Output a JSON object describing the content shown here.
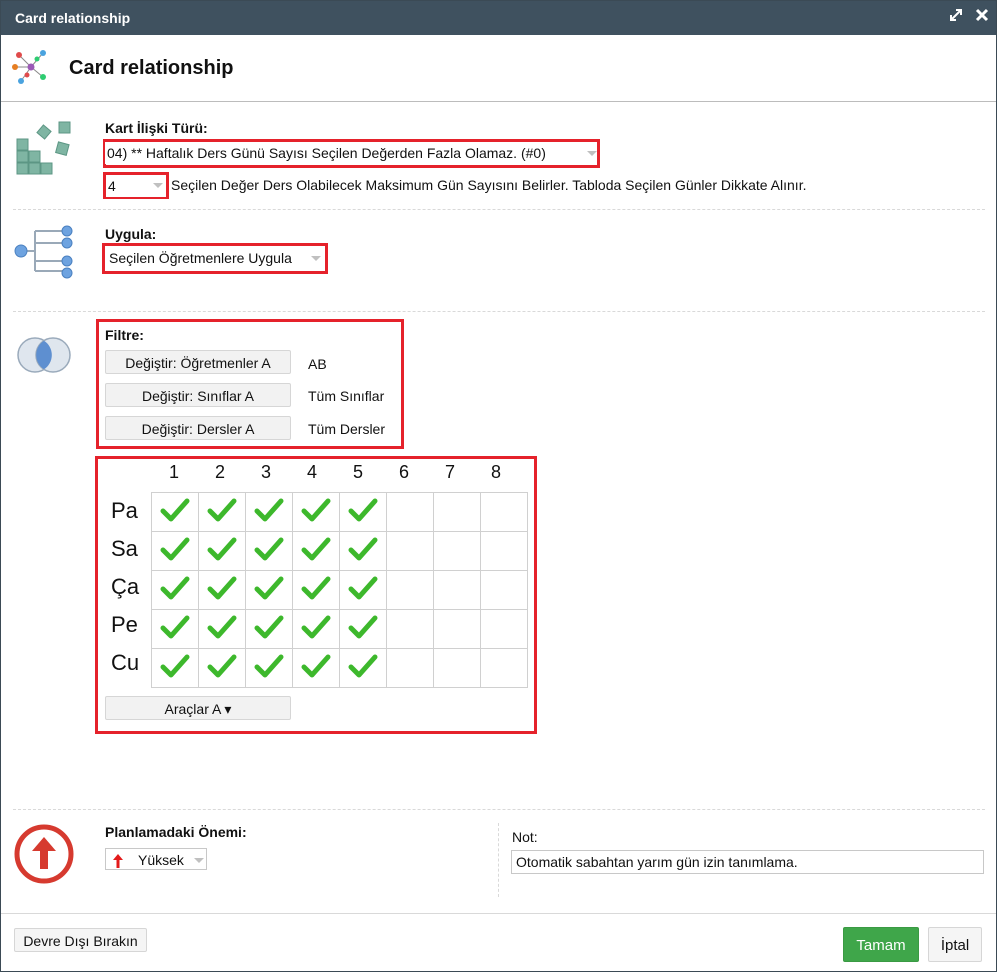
{
  "window": {
    "title": "Card relationship"
  },
  "header": {
    "title": "Card relationship"
  },
  "relation": {
    "label": "Kart İlişki Türü:",
    "type_value": "04) ** Haftalık Ders Günü Sayısı Seçilen Değerden Fazla Olamaz. (#0)",
    "count_value": "4",
    "description": "Seçilen Değer Ders Olabilecek Maksimum Gün Sayısını Belirler. Tabloda Seçilen Günler Dikkate Alınır."
  },
  "apply": {
    "label": "Uygula:",
    "value": "Seçilen Öğretmenlere Uygula"
  },
  "filter": {
    "label": "Filtre:",
    "rows": [
      {
        "button": "Değiştir: Öğretmenler A",
        "value": "AB"
      },
      {
        "button": "Değiştir: Sınıflar A",
        "value": "Tüm Sınıflar"
      },
      {
        "button": "Değiştir: Dersler A",
        "value": "Tüm Dersler"
      }
    ]
  },
  "schedule": {
    "columns": [
      "1",
      "2",
      "3",
      "4",
      "5",
      "6",
      "7",
      "8"
    ],
    "days": [
      "Pa",
      "Sa",
      "Ça",
      "Pe",
      "Cu"
    ],
    "checked": [
      [
        1,
        1,
        1,
        1,
        1,
        0,
        0,
        0
      ],
      [
        1,
        1,
        1,
        1,
        1,
        0,
        0,
        0
      ],
      [
        1,
        1,
        1,
        1,
        1,
        0,
        0,
        0
      ],
      [
        1,
        1,
        1,
        1,
        1,
        0,
        0,
        0
      ],
      [
        1,
        1,
        1,
        1,
        1,
        0,
        0,
        0
      ]
    ],
    "tools_button": "Araçlar A ▾"
  },
  "importance": {
    "label": "Planlamadaki Önemi:",
    "value": "Yüksek"
  },
  "note": {
    "label": "Not:",
    "value": "Otomatik sabahtan yarım gün izin tanımlama."
  },
  "footer": {
    "disable_button": "Devre Dışı Bırakın",
    "ok_button": "Tamam",
    "cancel_button": "İptal"
  },
  "colors": {
    "titlebar": "#3f515f",
    "accent_red": "#e5222b",
    "ok_green": "#3fa64a",
    "check_green": "#3db82c"
  }
}
